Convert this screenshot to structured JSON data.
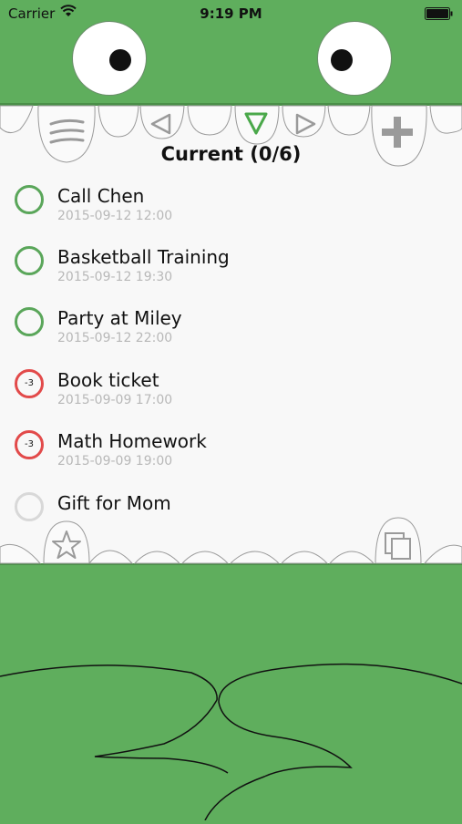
{
  "status_bar": {
    "carrier": "Carrier",
    "time": "9:19 PM"
  },
  "header": {
    "title": "Current (0/6)"
  },
  "toolbar": {
    "menu_icon": "menu-icon",
    "prev_icon": "triangle-left-icon",
    "filter_icon": "triangle-down-icon",
    "next_icon": "triangle-right-icon",
    "add_icon": "plus-icon",
    "star_icon": "star-icon",
    "copy_icon": "copy-icon"
  },
  "colors": {
    "green": "#5fae5d",
    "done_ring": "#5aa65a",
    "overdue_ring": "#e24a4a",
    "pending_ring": "#d8d8d8"
  },
  "tasks": [
    {
      "title": "Call Chen",
      "date": "2015-09-12 12:00",
      "status": "upcoming",
      "badge": ""
    },
    {
      "title": "Basketball Training",
      "date": "2015-09-12 19:30",
      "status": "upcoming",
      "badge": ""
    },
    {
      "title": "Party at Miley",
      "date": "2015-09-12 22:00",
      "status": "upcoming",
      "badge": ""
    },
    {
      "title": "Book ticket",
      "date": "2015-09-09 17:00",
      "status": "overdue",
      "badge": "-3"
    },
    {
      "title": "Math Homework",
      "date": "2015-09-09 19:00",
      "status": "overdue",
      "badge": "-3"
    },
    {
      "title": "Gift for Mom",
      "date": "",
      "status": "pending",
      "badge": ""
    }
  ]
}
